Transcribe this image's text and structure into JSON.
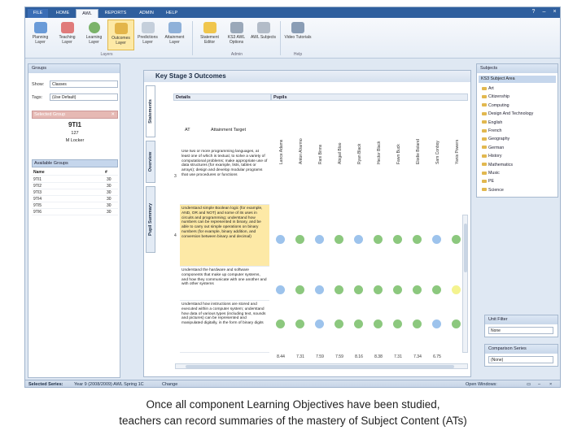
{
  "menu": {
    "tabs": [
      "FILE",
      "HOME",
      "AWL",
      "REPORTS",
      "ADMIN",
      "HELP"
    ],
    "active": "AWL"
  },
  "ribbon": {
    "buttons": [
      {
        "label": "Planning Layer",
        "color": "#6a9bd8"
      },
      {
        "label": "Teaching Layer",
        "color": "#e07b7b"
      },
      {
        "label": "Learning Layer",
        "color": "#7bb36a"
      },
      {
        "label": "Outcomes Layer",
        "color": "#e3b54a"
      },
      {
        "label": "Predictions Layer",
        "color": "#c5cfdb"
      },
      {
        "label": "Attainment Layer",
        "color": "#8fb1d9"
      },
      {
        "label": "Statement Editor",
        "color": "#f0c64d"
      },
      {
        "label": "KS3 AWL Options",
        "color": "#9aa8b9"
      },
      {
        "label": "AWL Subjects",
        "color": "#b3bcc8"
      },
      {
        "label": "Video Tutorials",
        "color": "#8a9db5"
      }
    ],
    "groups": [
      "Layers",
      "Admin",
      "Help"
    ]
  },
  "groups_panel": {
    "title": "Groups",
    "show_label": "Show:",
    "show_value": "Classes",
    "tags_label": "Tags:",
    "tags_value": "(Use Default)",
    "selected_group_title": "Selected Group",
    "selected_name": "9TI1",
    "selected_count": "127",
    "selected_teacher": "M Locker",
    "available_title": "Available Groups",
    "col_name": "Name",
    "col_num": "#",
    "rows": [
      {
        "name": "9TI1",
        "count": "30"
      },
      {
        "name": "9TI2",
        "count": "30"
      },
      {
        "name": "9TI3",
        "count": "30"
      },
      {
        "name": "9TI4",
        "count": "30"
      },
      {
        "name": "9TI5",
        "count": "30"
      },
      {
        "name": "9TI6",
        "count": "30"
      }
    ]
  },
  "main": {
    "title": "Key Stage 3 Outcomes",
    "vtabs": [
      "Statements",
      "Overview",
      "Pupil Summary"
    ],
    "details_header": "Details",
    "pupils_header": "Pupils",
    "at_header": "AT",
    "target_header": "Attainment Target",
    "pupils": [
      "Lance Adams",
      "Anton Alrarmo",
      "Rani Binns",
      "Abigail Bloo",
      "Ryan Black",
      "Hector Black",
      "Fawn Buck",
      "Elodie Boland",
      "Sam Conboy",
      "Yanis Powers"
    ],
    "statements": [
      {
        "num": "3",
        "text": "Use two or more programming languages, at least one of which is textual, to solve a variety of computational problems; make appropriate use of data structures (for example, lists, tables or arrays); design and develop modular programs that use procedures or functions",
        "highlight": false
      },
      {
        "num": "4",
        "text": "Understand simple Boolean logic (for example, AND, OR and NOT) and some of its uses in circuits and programming; understand how numbers can be represented in binary, and be able to carry out simple operations on binary numbers (for example, binary addition, and conversion between binary and decimal)",
        "highlight": true
      },
      {
        "num": "",
        "text": "Understand the hardware and software components that make up computer systems, and how they communicate with one another and with other systems",
        "highlight": false
      },
      {
        "num": "",
        "text": "Understand how instructions are stored and executed within a computer system; understand how data of various types (including text, sounds and pictures) can be represented and manipulated digitally, in the form of binary digits",
        "highlight": false
      }
    ],
    "dots": [
      [
        "blue",
        "green",
        "blue",
        "green",
        "blue",
        "green",
        "green",
        "green",
        "blue",
        "green"
      ],
      [
        "blue",
        "green",
        "blue",
        "green",
        "green",
        "green",
        "green",
        "green",
        "green",
        "yellow"
      ],
      [
        "green",
        "green",
        "blue",
        "green",
        "green",
        "green",
        "green",
        "green",
        "blue",
        "green"
      ]
    ],
    "averages": [
      "8.44",
      "7.31",
      "7.59",
      "7.59",
      "8.16",
      "8.38",
      "7.31",
      "7.34",
      "6.75",
      ""
    ]
  },
  "colors": {
    "blue": "#9dc3ec",
    "green": "#8cc87e",
    "yellow": "#f4f38f"
  },
  "subjects_panel": {
    "title": "Subjects",
    "area": "KS3 Subject Area",
    "items": [
      "Art",
      "Citizenship",
      "Computing",
      "Design And Technology",
      "English",
      "French",
      "Geography",
      "German",
      "History",
      "Mathematics",
      "Music",
      "PE",
      "Science"
    ],
    "unit_filter_title": "Unit Filter",
    "unit_filter_value": "None",
    "comparison_title": "Comparison Series",
    "comparison_value": "(None)"
  },
  "status": {
    "label": "Selected Series:",
    "value": "Year 9 (2008/2009) AWL Spring 1C",
    "change": "Change",
    "open_windows": "Open Windows:"
  },
  "caption": {
    "line1": "Once all component Learning Objectives have been studied,",
    "line2": "teachers can record summaries of the mastery of Subject Content (ATs)"
  }
}
